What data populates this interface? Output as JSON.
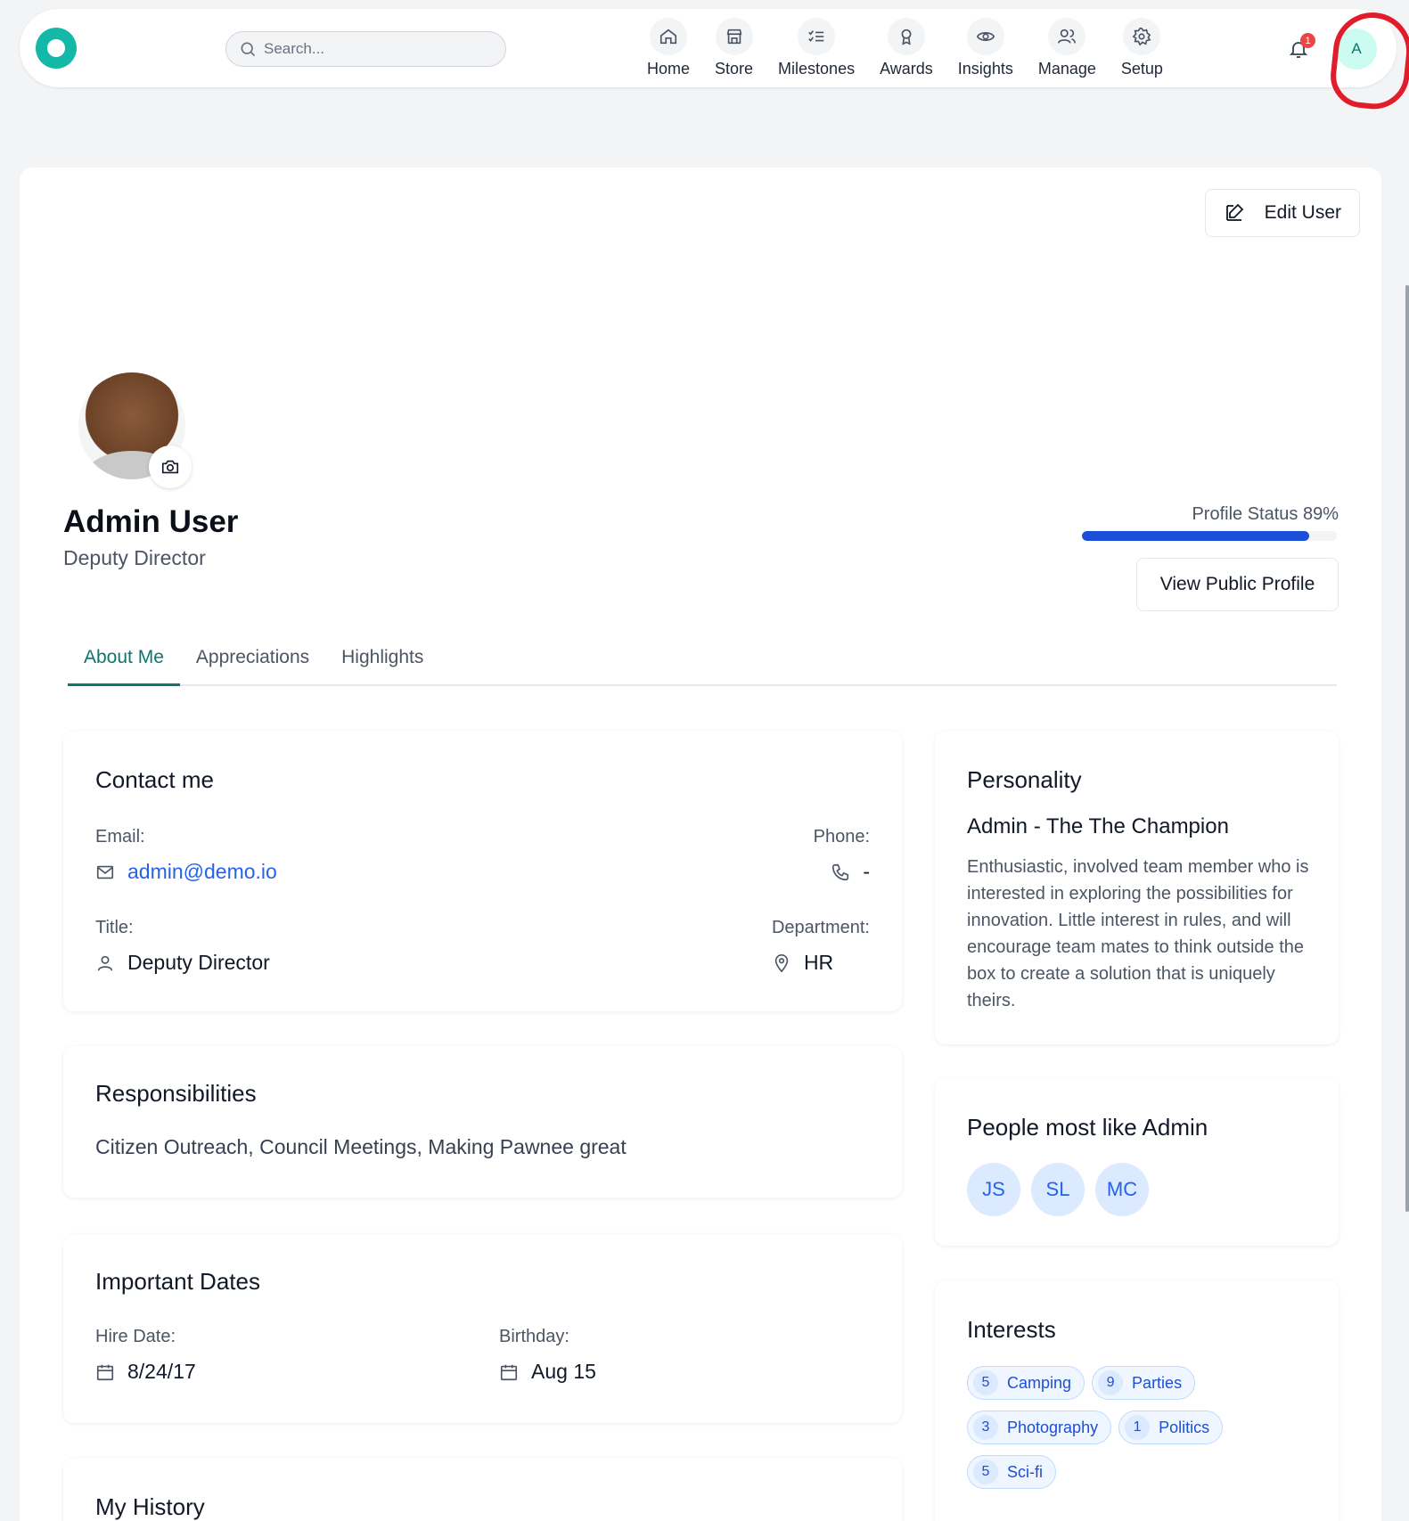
{
  "header": {
    "search_placeholder": "Search...",
    "nav": [
      {
        "label": "Home",
        "icon": "home-icon"
      },
      {
        "label": "Store",
        "icon": "store-icon"
      },
      {
        "label": "Milestones",
        "icon": "checklist-icon"
      },
      {
        "label": "Awards",
        "icon": "award-icon"
      },
      {
        "label": "Insights",
        "icon": "eye-icon"
      },
      {
        "label": "Manage",
        "icon": "users-icon"
      },
      {
        "label": "Setup",
        "icon": "gear-icon"
      }
    ],
    "notification_count": "1",
    "avatar_initial": "A"
  },
  "profile": {
    "edit_label": "Edit User",
    "name": "Admin User",
    "role": "Deputy Director",
    "status_label": "Profile Status 89%",
    "status_value": 0.89,
    "view_public_label": "View Public Profile"
  },
  "tabs": [
    {
      "label": "About Me",
      "active": true
    },
    {
      "label": "Appreciations",
      "active": false
    },
    {
      "label": "Highlights",
      "active": false
    }
  ],
  "contact": {
    "title": "Contact me",
    "email_label": "Email:",
    "email": "admin@demo.io",
    "phone_label": "Phone:",
    "phone": "-",
    "title_label": "Title:",
    "title_value": "Deputy Director",
    "department_label": "Department:",
    "department": "HR"
  },
  "responsibilities": {
    "title": "Responsibilities",
    "text": "Citizen Outreach, Council Meetings, Making Pawnee great"
  },
  "dates": {
    "title": "Important Dates",
    "hire_label": "Hire Date:",
    "hire": "8/24/17",
    "birthday_label": "Birthday:",
    "birthday": "Aug 15"
  },
  "history": {
    "title": "My History"
  },
  "personality": {
    "title": "Personality",
    "subtitle": "Admin - The The Champion",
    "description": "Enthusiastic, involved team member who is interested in exploring the possibilities for innovation. Little interest in rules, and will encourage team mates to think outside the box to create a solution that is uniquely theirs."
  },
  "people": {
    "title": "People most like Admin",
    "initials": [
      "JS",
      "SL",
      "MC"
    ]
  },
  "interests": {
    "title": "Interests",
    "items": [
      {
        "count": "5",
        "label": "Camping"
      },
      {
        "count": "9",
        "label": "Parties"
      },
      {
        "count": "3",
        "label": "Photography"
      },
      {
        "count": "1",
        "label": "Politics"
      },
      {
        "count": "5",
        "label": "Sci-fi"
      }
    ]
  },
  "colors": {
    "accent": "#0f766e",
    "logo": "#14b8a6",
    "progress": "#1d4ed8",
    "link": "#2563eb",
    "annotation": "#e11d2b"
  }
}
